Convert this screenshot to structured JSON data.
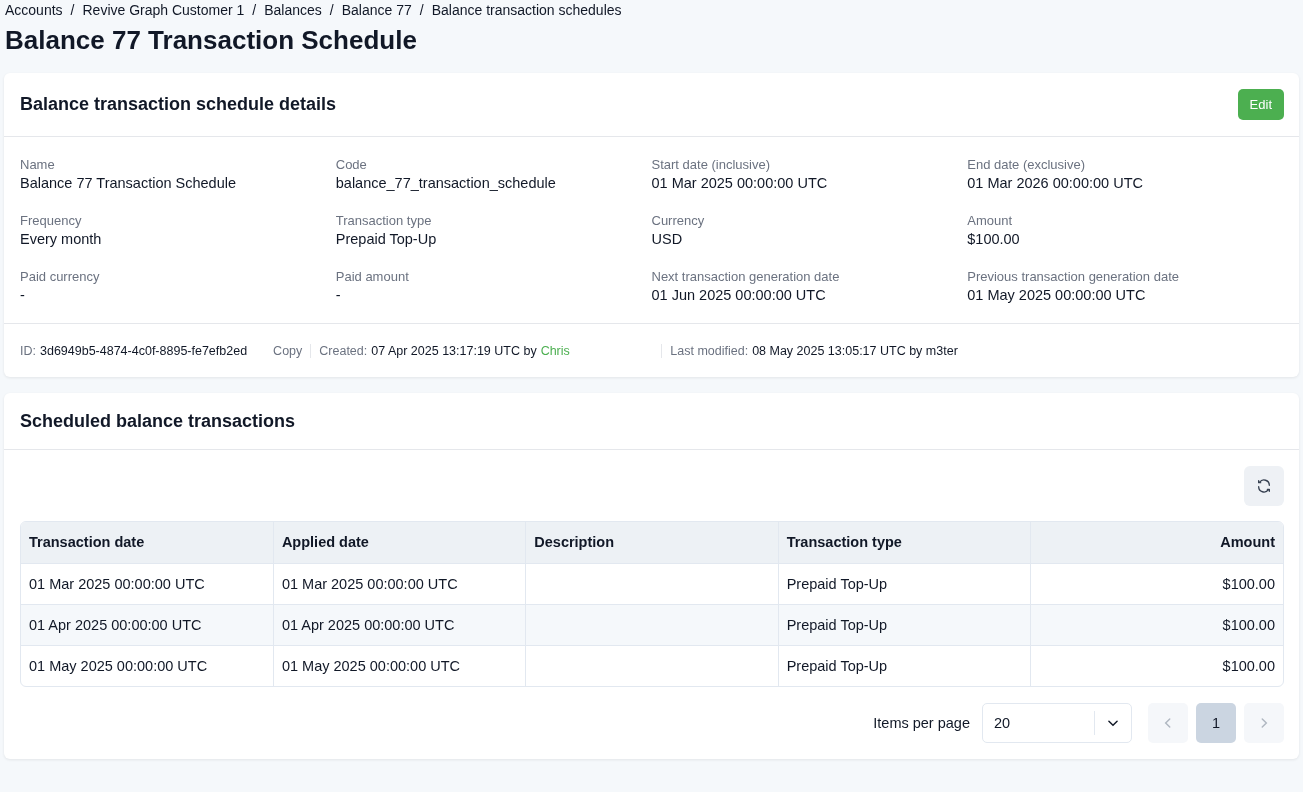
{
  "breadcrumbs": [
    "Accounts",
    "Revive Graph Customer 1",
    "Balances",
    "Balance 77",
    "Balance transaction schedules"
  ],
  "breadcrumb_separator": "/",
  "title": "Balance 77 Transaction Schedule",
  "details": {
    "heading": "Balance transaction schedule details",
    "edit_button": "Edit",
    "fields": [
      {
        "label": "Name",
        "value": "Balance 77 Transaction Schedule"
      },
      {
        "label": "Code",
        "value": "balance_77_transaction_schedule"
      },
      {
        "label": "Start date (inclusive)",
        "value": "01 Mar 2025 00:00:00 UTC"
      },
      {
        "label": "End date (exclusive)",
        "value": "01 Mar 2026 00:00:00 UTC"
      },
      {
        "label": "Frequency",
        "value": "Every month"
      },
      {
        "label": "Transaction type",
        "value": "Prepaid Top-Up"
      },
      {
        "label": "Currency",
        "value": "USD"
      },
      {
        "label": "Amount",
        "value": "$100.00"
      },
      {
        "label": "Paid currency",
        "value": "-"
      },
      {
        "label": "Paid amount",
        "value": "-"
      },
      {
        "label": "Next transaction generation date",
        "value": "01 Jun 2025 00:00:00 UTC"
      },
      {
        "label": "Previous transaction generation date",
        "value": "01 May 2025 00:00:00 UTC"
      }
    ],
    "footer": {
      "id_label": "ID:",
      "id": "3d6949b5-4874-4c0f-8895-fe7efb2ed",
      "copy": "Copy",
      "created_label": "Created:",
      "created": "07 Apr 2025 13:17:19 UTC by",
      "created_by": "Chris",
      "modified_label": "Last modified:",
      "modified": "08 May 2025 13:05:17 UTC by m3ter"
    }
  },
  "transactions": {
    "heading": "Scheduled balance transactions",
    "columns": [
      "Transaction date",
      "Applied date",
      "Description",
      "Transaction type",
      "Amount"
    ],
    "rows": [
      [
        "01 Mar 2025 00:00:00 UTC",
        "01 Mar 2025 00:00:00 UTC",
        "",
        "Prepaid Top-Up",
        "$100.00"
      ],
      [
        "01 Apr 2025 00:00:00 UTC",
        "01 Apr 2025 00:00:00 UTC",
        "",
        "Prepaid Top-Up",
        "$100.00"
      ],
      [
        "01 May 2025 00:00:00 UTC",
        "01 May 2025 00:00:00 UTC",
        "",
        "Prepaid Top-Up",
        "$100.00"
      ]
    ],
    "pagination": {
      "items_per_page_label": "Items per page",
      "items_per_page": "20",
      "prev_disabled": true,
      "next_disabled": true,
      "pages": [
        {
          "label": "1",
          "selected": true
        }
      ]
    }
  }
}
